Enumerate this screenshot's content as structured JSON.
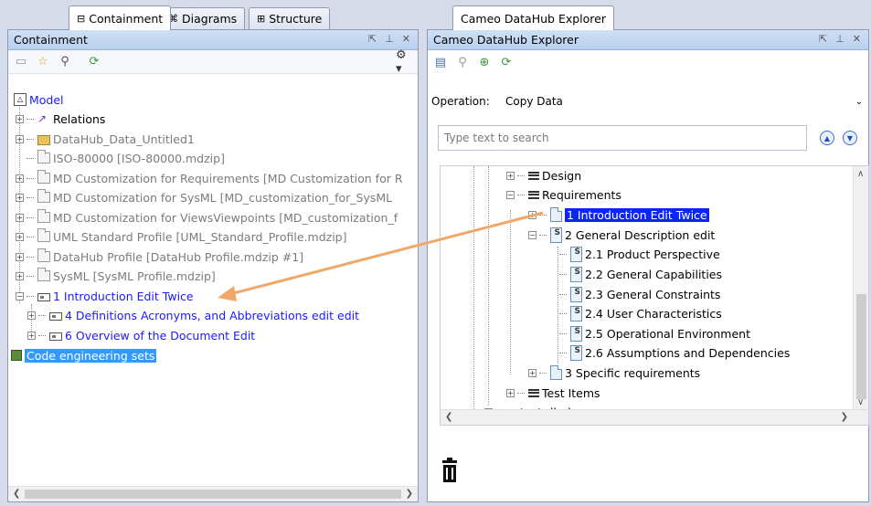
{
  "left_tabs": [
    {
      "label": "Containment",
      "icon": "containment-tab-icon"
    },
    {
      "label": "Diagrams",
      "icon": "diagrams-tab-icon"
    },
    {
      "label": "Structure",
      "icon": "structure-tab-icon"
    }
  ],
  "right_tabs": [
    {
      "label": "Cameo DataHub Explorer"
    }
  ],
  "containment": {
    "title": "Containment",
    "controls": [
      "undock-icon",
      "pin-icon",
      "close-icon"
    ],
    "toolbar_icons": [
      "open-icon",
      "star-icon",
      "search-icon",
      "sync-icon",
      "settings-gear-icon"
    ],
    "tree": [
      {
        "label": "Model",
        "style": "blue",
        "icon": "model-icon",
        "expander": "",
        "level": 0
      },
      {
        "label": "Relations",
        "style": "normal",
        "icon": "relations-icon",
        "expander": "+",
        "level": 0
      },
      {
        "label": "DataHub_Data_Untitled1",
        "style": "gray",
        "icon": "folder-icon",
        "expander": "+",
        "level": 0
      },
      {
        "label": "ISO-80000 [ISO-80000.mdzip]",
        "style": "gray",
        "icon": "package-icon",
        "expander": "",
        "level": 0
      },
      {
        "label": "MD Customization for Requirements [MD Customization for R",
        "style": "gray",
        "icon": "package-icon",
        "expander": "+",
        "level": 0
      },
      {
        "label": "MD Customization for SysML [MD_customization_for_SysML",
        "style": "gray",
        "icon": "package-icon",
        "expander": "+",
        "level": 0
      },
      {
        "label": "MD Customization for ViewsViewpoints [MD_customization_f",
        "style": "gray",
        "icon": "package-icon",
        "expander": "+",
        "level": 0
      },
      {
        "label": "UML Standard Profile [UML_Standard_Profile.mdzip]",
        "style": "gray",
        "icon": "package-icon",
        "expander": "+",
        "level": 0
      },
      {
        "label": "DataHub Profile [DataHub Profile.mdzip #1]",
        "style": "gray",
        "icon": "profile-icon",
        "expander": "+",
        "level": 0
      },
      {
        "label": "SysML [SysML Profile.mdzip]",
        "style": "gray",
        "icon": "profile-icon",
        "expander": "+",
        "level": 0
      },
      {
        "label": "1 Introduction Edit Twice",
        "style": "blue",
        "icon": "requirement-icon",
        "expander": "-",
        "level": 0
      },
      {
        "label": "4 Definitions Acronyms, and Abbreviations edit edit",
        "style": "blue",
        "icon": "requirement-icon",
        "expander": "+",
        "level": 1
      },
      {
        "label": "6 Overview of the Document Edit",
        "style": "blue",
        "icon": "requirement-icon",
        "expander": "+",
        "level": 1
      },
      {
        "label": "Code engineering sets",
        "style": "highlight",
        "icon": "code-engineering-icon",
        "expander": "",
        "level": -1
      }
    ]
  },
  "explorer": {
    "title": "Cameo DataHub Explorer",
    "controls": [
      "undock-icon",
      "pin-icon",
      "close-icon"
    ],
    "toolbar_icons": [
      "database-icon",
      "search-icon",
      "add-icon",
      "sync-icon"
    ],
    "operation_label": "Operation:",
    "operation_value": "Copy Data",
    "search_placeholder": "Type text to search",
    "tree": [
      {
        "label": "Design",
        "icon": "list-icon",
        "expander": "+",
        "level": 2
      },
      {
        "label": "Requirements",
        "icon": "list-icon",
        "expander": "-",
        "level": 2
      },
      {
        "label": "1 Introduction Edit Twice",
        "icon": "document-icon",
        "expander": "+",
        "level": 3,
        "selected": true
      },
      {
        "label": "2 General Description edit",
        "icon": "spec-icon",
        "expander": "-",
        "level": 3
      },
      {
        "label": "2.1 Product Perspective",
        "icon": "spec-icon",
        "expander": "",
        "level": 4
      },
      {
        "label": "2.2 General Capabilities",
        "icon": "spec-icon",
        "expander": "",
        "level": 4
      },
      {
        "label": "2.3 General Constraints",
        "icon": "spec-icon",
        "expander": "",
        "level": 4
      },
      {
        "label": "2.4 User Characteristics",
        "icon": "spec-icon",
        "expander": "",
        "level": 4
      },
      {
        "label": "2.5 Operational Environment",
        "icon": "spec-icon",
        "expander": "",
        "level": 4
      },
      {
        "label": "2.6 Assumptions and Dependencies",
        "icon": "spec-icon",
        "expander": "",
        "level": 4
      },
      {
        "label": "3 Specific requirements",
        "icon": "document-icon",
        "expander": "+",
        "level": 3
      },
      {
        "label": "Test Items",
        "icon": "list-icon",
        "expander": "+",
        "level": 2
      },
      {
        "label": "test-dhub",
        "icon": "folder-icon",
        "expander": "+",
        "level": 1
      }
    ],
    "trash_icon": "trash-icon"
  },
  "colors": {
    "selection": "#0b24fb",
    "highlight": "#3399ff",
    "link_text": "#1a1aff",
    "arrow": "#f0a868",
    "titlebar": "#c4d8f1"
  }
}
